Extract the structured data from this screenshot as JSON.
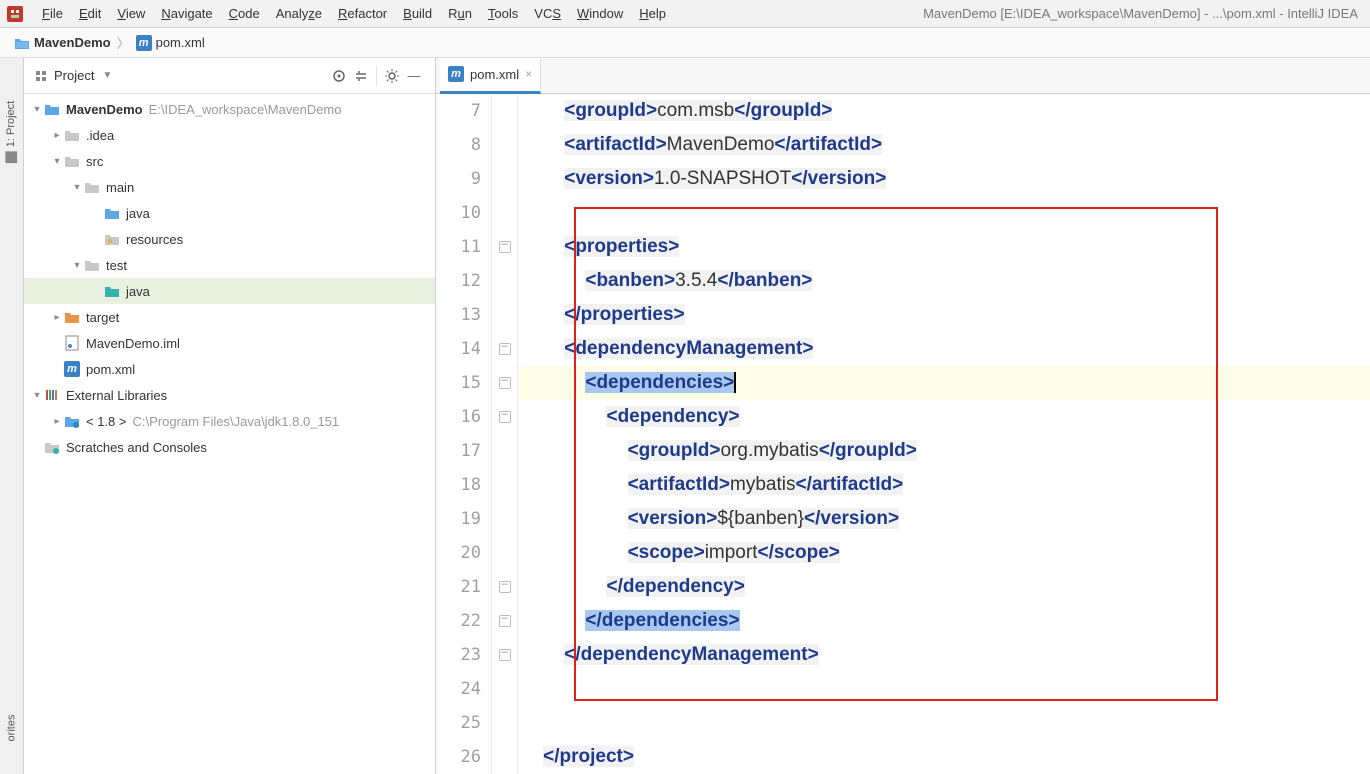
{
  "window_title": "MavenDemo [E:\\IDEA_workspace\\MavenDemo] - ...\\pom.xml - IntelliJ IDEA",
  "menu": [
    "File",
    "Edit",
    "View",
    "Navigate",
    "Code",
    "Analyze",
    "Refactor",
    "Build",
    "Run",
    "Tools",
    "VCS",
    "Window",
    "Help"
  ],
  "breadcrumb": {
    "root": "MavenDemo",
    "file": "pom.xml"
  },
  "rail": {
    "project": "1: Project",
    "favorites": "orites"
  },
  "project_panel": {
    "title": "Project"
  },
  "tree": {
    "root": {
      "label": "MavenDemo",
      "hint": "E:\\IDEA_workspace\\MavenDemo"
    },
    "idea": ".idea",
    "src": "src",
    "main": "main",
    "java": "java",
    "resources": "resources",
    "test": "test",
    "java2": "java",
    "target": "target",
    "iml": "MavenDemo.iml",
    "pom": "pom.xml",
    "ext": "External Libraries",
    "jdk": "< 1.8 >",
    "jdk_hint": "C:\\Program Files\\Java\\jdk1.8.0_151",
    "scratches": "Scratches and Consoles"
  },
  "tab": {
    "name": "pom.xml"
  },
  "gutter_start": 7,
  "gutter_end": 26,
  "code": {
    "l7": {
      "indent": "        ",
      "tag_o": "<groupId>",
      "txt": "com.msb",
      "tag_c": "</groupId>"
    },
    "l8": {
      "indent": "        ",
      "tag_o": "<artifactId>",
      "txt": "MavenDemo",
      "tag_c": "</artifactId>"
    },
    "l9": {
      "indent": "        ",
      "tag_o": "<version>",
      "txt": "1.0-SNAPSHOT",
      "tag_c": "</version>"
    },
    "l11": {
      "indent": "        ",
      "tag_o": "<properties>"
    },
    "l12": {
      "indent": "            ",
      "tag_o": "<banben>",
      "txt": "3.5.4",
      "tag_c": "</banben>"
    },
    "l13": {
      "indent": "        ",
      "tag_o": "</properties>"
    },
    "l14": {
      "indent": "        ",
      "tag_o": "<dependencyManagement>"
    },
    "l15": {
      "indent": "            ",
      "tag_o": "<dependencies>"
    },
    "l16": {
      "indent": "                ",
      "tag_o": "<dependency>"
    },
    "l17": {
      "indent": "                    ",
      "tag_o": "<groupId>",
      "txt": "org.mybatis",
      "tag_c": "</groupId>"
    },
    "l18": {
      "indent": "                    ",
      "tag_o": "<artifactId>",
      "txt": "mybatis",
      "tag_c": "</artifactId>"
    },
    "l19": {
      "indent": "                    ",
      "tag_o": "<version>",
      "txt": "${banben}",
      "tag_c": "</version>"
    },
    "l20": {
      "indent": "                    ",
      "tag_o": "<scope>",
      "txt": "import",
      "tag_c": "</scope>"
    },
    "l21": {
      "indent": "                ",
      "tag_o": "</dependency>"
    },
    "l22": {
      "indent": "            ",
      "tag_o": "</dependencies>"
    },
    "l23": {
      "indent": "        ",
      "tag_o": "</dependencyManagement>"
    },
    "l26": {
      "indent": "    ",
      "tag_o": "</project>"
    }
  }
}
